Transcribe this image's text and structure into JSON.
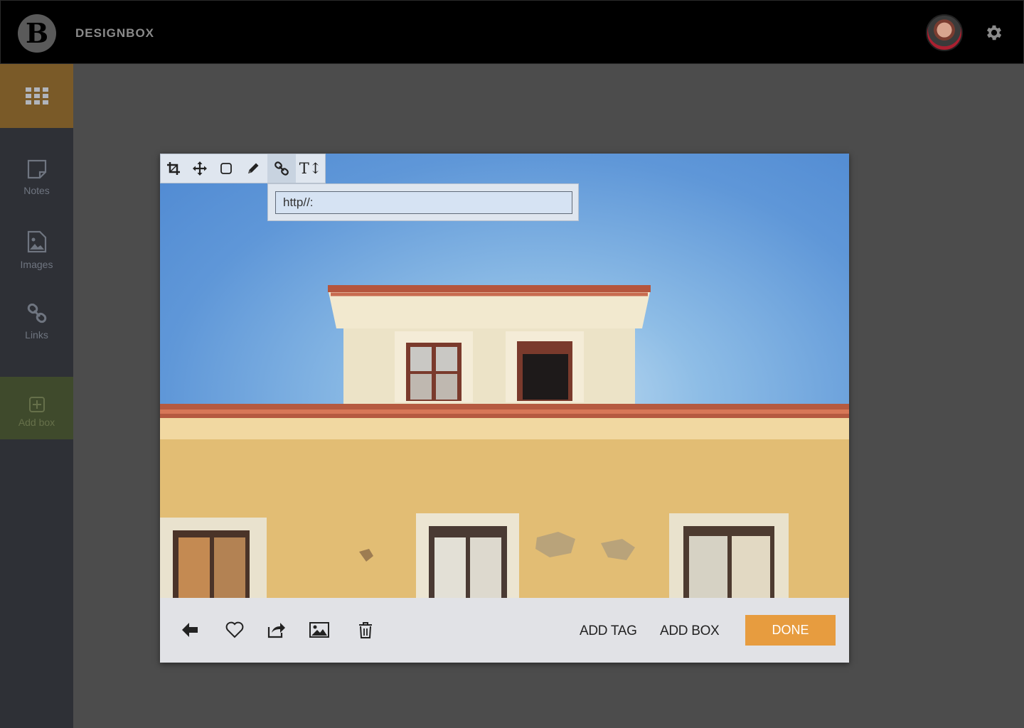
{
  "app": {
    "logo_letter": "B",
    "title": "DESIGNBOX"
  },
  "topbar": {
    "avatar_icon": "user-avatar",
    "settings_icon": "gear-icon"
  },
  "sidebar": {
    "apps_icon": "grid-icon",
    "items": [
      {
        "label": "Notes",
        "icon": "note-icon"
      },
      {
        "label": "Images",
        "icon": "image-file-icon"
      },
      {
        "label": "Links",
        "icon": "link-icon"
      }
    ],
    "add_box": {
      "label": "Add box",
      "icon": "plus-square-icon"
    }
  },
  "editor": {
    "toolbar": [
      {
        "icon": "crop-icon"
      },
      {
        "icon": "move-icon"
      },
      {
        "icon": "square-icon"
      },
      {
        "icon": "pencil-icon"
      },
      {
        "icon": "link-icon",
        "active": true
      },
      {
        "icon": "text-icon",
        "text": "T↕"
      }
    ],
    "url_input": {
      "value": "http//:",
      "placeholder": ""
    }
  },
  "footer": {
    "icons": [
      "back-arrow-icon",
      "heart-icon",
      "share-icon",
      "image-icon",
      "trash-icon"
    ],
    "add_tag": "ADD TAG",
    "add_box": "ADD BOX",
    "done": "DONE"
  },
  "colors": {
    "topbar": "#000000",
    "sidebar": "#2e3036",
    "sidebar_active": "#7a5a28",
    "sidebar_add": "#3f4a2c",
    "done_button": "#e79c3f",
    "footer": "#e1e2e6",
    "canvas": "#4c4c4c"
  }
}
